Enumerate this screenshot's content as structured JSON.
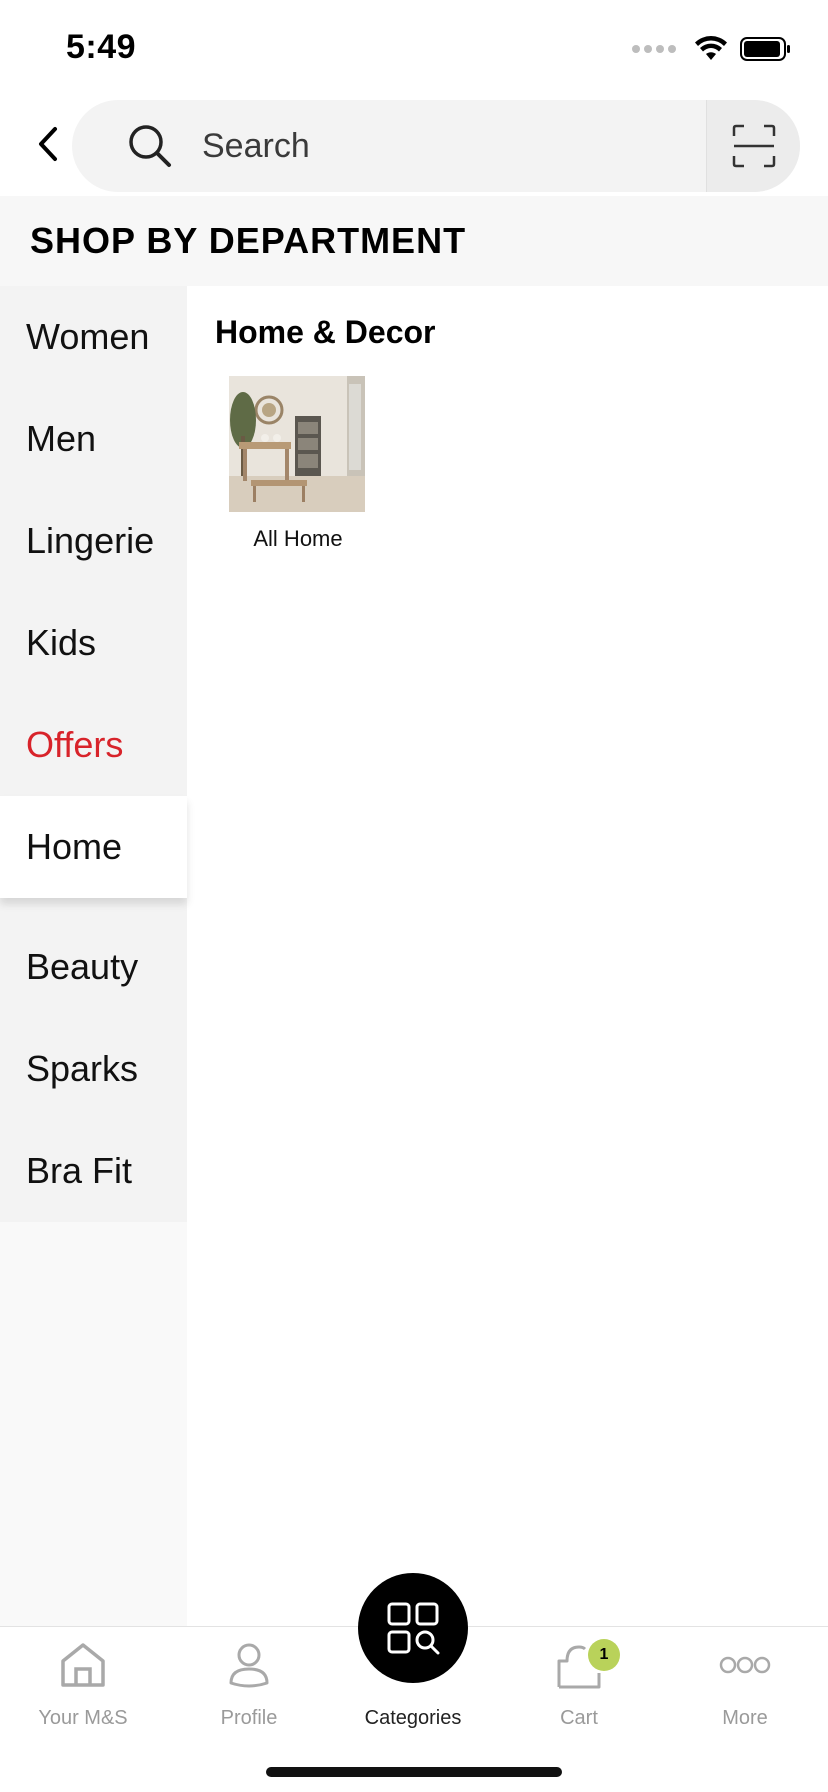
{
  "status_bar": {
    "time": "5:49"
  },
  "search": {
    "placeholder": "Search"
  },
  "department": {
    "heading": "SHOP BY DEPARTMENT"
  },
  "sidebar": {
    "items": [
      {
        "label": "Women"
      },
      {
        "label": "Men"
      },
      {
        "label": "Lingerie"
      },
      {
        "label": "Kids"
      },
      {
        "label": "Offers"
      },
      {
        "label": "Home"
      },
      {
        "label": "Beauty"
      },
      {
        "label": "Sparks"
      },
      {
        "label": "Bra Fit"
      }
    ],
    "selected": "Home",
    "offers_color": "#d8232a"
  },
  "content": {
    "title": "Home & Decor",
    "tiles": [
      {
        "label": "All Home",
        "image": "dining-room-image"
      }
    ]
  },
  "tab_bar": {
    "tabs": [
      {
        "label": "Your M&S",
        "icon": "home-icon"
      },
      {
        "label": "Profile",
        "icon": "profile-icon"
      },
      {
        "label": "Categories",
        "icon": "categories-icon"
      },
      {
        "label": "Cart",
        "icon": "cart-icon",
        "badge": "1"
      },
      {
        "label": "More",
        "icon": "more-icon"
      }
    ],
    "active": "Categories",
    "badge_color": "#b9d25a"
  }
}
